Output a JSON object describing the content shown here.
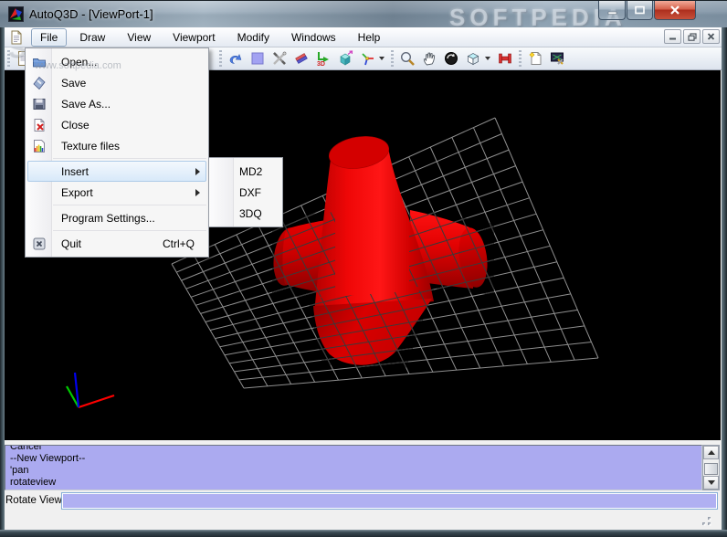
{
  "window": {
    "title": "AutoQ3D - [ViewPort-1]",
    "caption_buttons": [
      "minimize",
      "maximize",
      "close"
    ],
    "watermark_large": "SOFTPEDIA",
    "watermark_small": "www.softpedia.com"
  },
  "menubar": {
    "items": [
      "File",
      "Draw",
      "View",
      "Viewport",
      "Modify",
      "Windows",
      "Help"
    ],
    "active": "File"
  },
  "mdi_buttons": [
    "minimize",
    "restore",
    "close"
  ],
  "file_menu": [
    {
      "label": "Open...",
      "icon": "open-folder"
    },
    {
      "label": "Save",
      "icon": "save-disk"
    },
    {
      "label": "Save As...",
      "icon": "save-as-disk"
    },
    {
      "label": "Close",
      "icon": "close-doc"
    },
    {
      "label": "Texture files",
      "icon": "texture-doc"
    },
    {
      "separator": true
    },
    {
      "label": "Insert",
      "submenu": true,
      "highlighted": true
    },
    {
      "label": "Export",
      "submenu": true
    },
    {
      "separator": true
    },
    {
      "label": "Program Settings..."
    },
    {
      "separator": true
    },
    {
      "label": "Quit",
      "icon": "quit-box",
      "shortcut": "Ctrl+Q"
    }
  ],
  "insert_submenu": [
    "MD2",
    "DXF",
    "3DQ"
  ],
  "toolbar": {
    "icons_left": [
      "new-file"
    ],
    "icons_edit": [
      "undo",
      "color-swatch",
      "tools",
      "eraser",
      "move-3d",
      "extrude",
      "orientation-axes"
    ],
    "icons_view": [
      "zoom",
      "pan",
      "rotate-view",
      "view-mode-cube",
      "measure"
    ],
    "icons_right": [
      "new-part",
      "program-tools"
    ],
    "has_dropdowns": [
      "orientation-axes",
      "view-mode-cube"
    ]
  },
  "console": {
    "lines": [
      "Cancel",
      "--New Viewport--",
      "'pan",
      "rotateview"
    ]
  },
  "prompt": {
    "label": "Rotate View:",
    "value": ""
  },
  "scene": {
    "model": "red tetrapod of four truncated cones on wireframe grid",
    "model_color": "#e80000",
    "background": "#000000",
    "grid_color": "#8f8f8f",
    "axis_colors": {
      "x": "#ff0000",
      "y": "#00cc00",
      "z": "#0000ee"
    }
  }
}
